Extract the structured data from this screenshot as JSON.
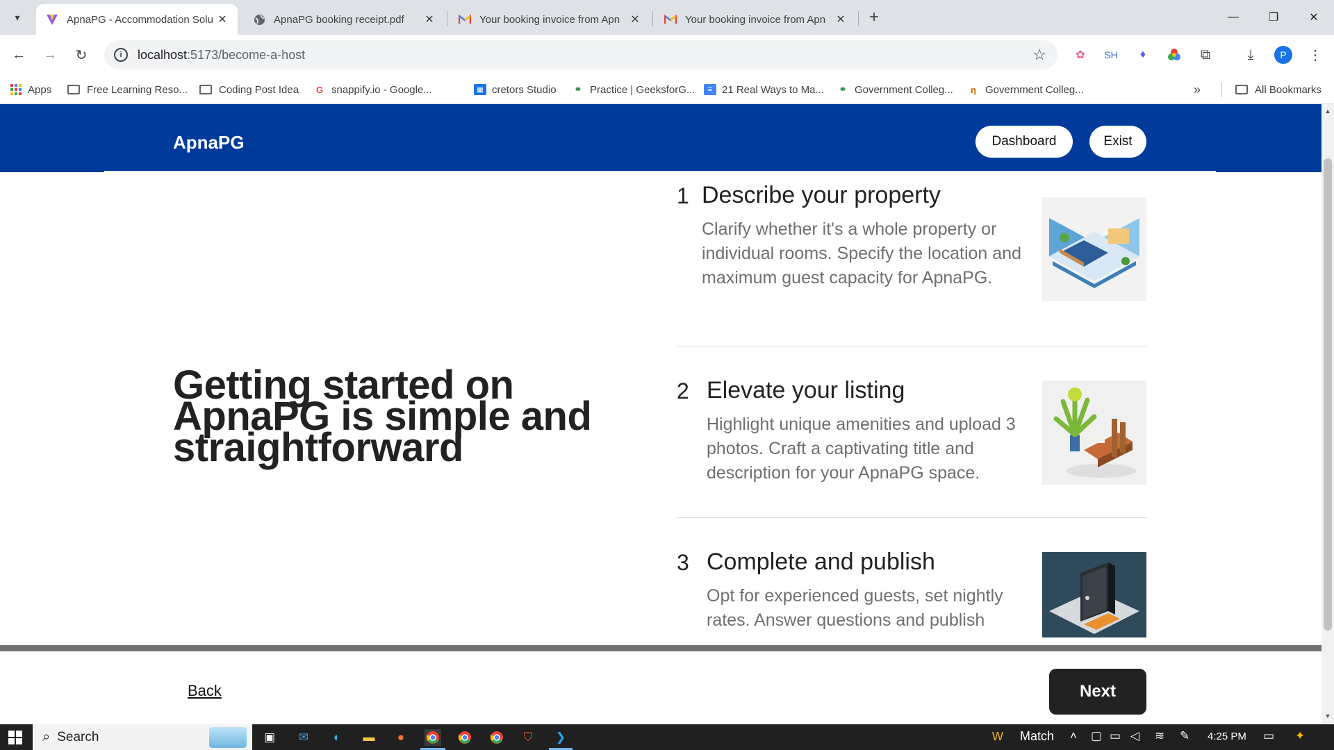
{
  "browser": {
    "tabs": [
      {
        "title": "ApnaPG - Accommodation Solu",
        "active": true,
        "icon": "vite-icon"
      },
      {
        "title": "ApnaPG booking receipt.pdf",
        "active": false,
        "icon": "globe-icon"
      },
      {
        "title": "Your booking invoice from Apn",
        "active": false,
        "icon": "gmail-icon"
      },
      {
        "title": "Your booking invoice from Apn",
        "active": false,
        "icon": "gmail-icon"
      }
    ],
    "url_host": "localhost",
    "url_path": ":5173/become-a-host",
    "profile_initial": "P",
    "extension_sh": "SH"
  },
  "bookmarks": [
    {
      "label": "Apps",
      "icon": "apps-grid-icon"
    },
    {
      "label": "Free Learning Reso...",
      "icon": "folder-icon"
    },
    {
      "label": "Coding Post Idea",
      "icon": "folder-icon"
    },
    {
      "label": "snappify.io - Google...",
      "icon": "google-icon"
    },
    {
      "label": "cretors Studio",
      "icon": "calendar-icon"
    },
    {
      "label": "Practice | GeeksforG...",
      "icon": "gfg-icon"
    },
    {
      "label": "21 Real Ways to Ma...",
      "icon": "docs-icon"
    },
    {
      "label": "Government Colleg...",
      "icon": "gfg-icon"
    },
    {
      "label": "Government Colleg...",
      "icon": "tn-icon"
    }
  ],
  "all_bookmarks": "All Bookmarks",
  "page": {
    "logo": "ApnaPG",
    "dashboard_label": "Dashboard",
    "exit_label": "Exist",
    "hero": "Getting started on ApnaPG is simple and straightforward",
    "steps": [
      {
        "number": "1",
        "title": "Describe your property",
        "description": "Clarify whether it's a whole property or individual rooms. Specify the location and maximum guest capacity for ApnaPG.",
        "image": "bedroom-illustration"
      },
      {
        "number": "2",
        "title": "Elevate your listing",
        "description": "Highlight unique amenities and upload 3 photos. Craft a captivating title and description for your ApnaPG space.",
        "image": "plant-bench-illustration"
      },
      {
        "number": "3",
        "title": "Complete and publish",
        "description": "Opt for experienced guests, set nightly rates. Answer questions and publish",
        "image": "door-illustration"
      }
    ],
    "back_label": "Back",
    "next_label": "Next"
  },
  "taskbar": {
    "search_label": "Search",
    "weather_label": "Match",
    "time": "4:25 PM"
  },
  "colors": {
    "header_blue": "#003a9b",
    "next_button": "#222222",
    "tab_strip": "#dee1e6"
  }
}
